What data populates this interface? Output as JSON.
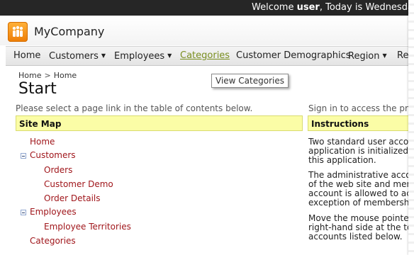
{
  "topbar": {
    "welcome_prefix": "Welcome ",
    "user": "user",
    "welcome_suffix": ", Today is Wednesday,"
  },
  "header": {
    "company": "MyCompany",
    "logo_icon": "people-group-icon",
    "logo_color": "#f39200"
  },
  "menu": [
    {
      "label": "Home",
      "has_dropdown": false
    },
    {
      "label": "Customers",
      "has_dropdown": true
    },
    {
      "label": "Employees",
      "has_dropdown": true
    },
    {
      "label": "Categories",
      "has_dropdown": false,
      "active": true
    },
    {
      "label": "Customer Demographics",
      "has_dropdown": false
    },
    {
      "label": "Region",
      "has_dropdown": true
    },
    {
      "label": "Re",
      "has_dropdown": false
    }
  ],
  "tooltip": "View Categories",
  "breadcrumb": {
    "first": "Home",
    "separator": ">",
    "second": "Home"
  },
  "page_title": "Start",
  "left": {
    "instruction": "Please select a page link in the table of contents below.",
    "panel_title": "Site Map",
    "tree": [
      {
        "label": "Home",
        "level": 0,
        "toggle": false
      },
      {
        "label": "Customers",
        "level": 0,
        "toggle": true
      },
      {
        "label": "Orders",
        "level": 1,
        "toggle": false
      },
      {
        "label": "Customer Demo",
        "level": 1,
        "toggle": false
      },
      {
        "label": "Order Details",
        "level": 1,
        "toggle": false
      },
      {
        "label": "Employees",
        "level": 0,
        "toggle": true
      },
      {
        "label": "Employee Territories",
        "level": 1,
        "toggle": false
      },
      {
        "label": "Categories",
        "level": 0,
        "toggle": false
      }
    ]
  },
  "right": {
    "instruction": "Sign in to access the pro",
    "panel_title": "Instructions",
    "paragraphs": [
      "Two standard user acco\napplication is initialized i\nthis application.",
      "The administrative acco\nof the web site and men\naccount is allowed to ac\nexception of membershi",
      "Move the mouse pointer\nright-hand side at the to\naccounts listed below."
    ]
  },
  "colors": {
    "topbar": "#262626",
    "link": "#a0161b",
    "active_menu": "#7a8f20",
    "panel_header": "#fbfda6"
  }
}
